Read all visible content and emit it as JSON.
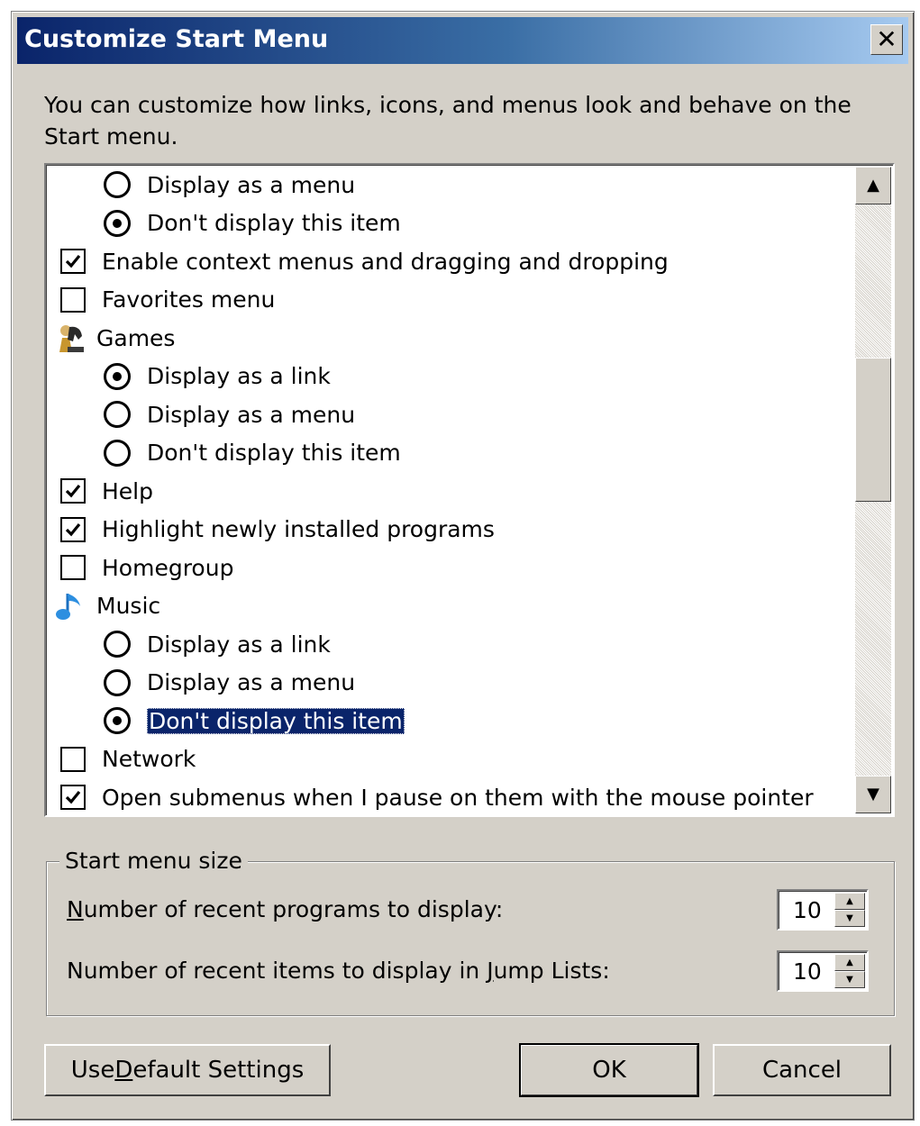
{
  "window": {
    "title": "Customize Start Menu",
    "close_symbol": "✕"
  },
  "intro": "You can customize how links, icons, and menus look and behave on the Start menu.",
  "list": {
    "items": [
      {
        "type": "radio",
        "label": "Display as a menu",
        "checked": false
      },
      {
        "type": "radio",
        "label": "Don't display this item",
        "checked": true
      },
      {
        "type": "checkbox",
        "label": "Enable context menus and dragging and dropping",
        "checked": true
      },
      {
        "type": "checkbox",
        "label": "Favorites menu",
        "checked": false
      },
      {
        "type": "header",
        "label": "Games",
        "icon": "games-chess-icon"
      },
      {
        "type": "radio",
        "label": "Display as a link",
        "checked": true
      },
      {
        "type": "radio",
        "label": "Display as a menu",
        "checked": false
      },
      {
        "type": "radio",
        "label": "Don't display this item",
        "checked": false
      },
      {
        "type": "checkbox",
        "label": "Help",
        "checked": true
      },
      {
        "type": "checkbox",
        "label": "Highlight newly installed programs",
        "checked": true
      },
      {
        "type": "checkbox",
        "label": "Homegroup",
        "checked": false
      },
      {
        "type": "header",
        "label": "Music",
        "icon": "music-note-icon"
      },
      {
        "type": "radio",
        "label": "Display as a link",
        "checked": false
      },
      {
        "type": "radio",
        "label": "Display as a menu",
        "checked": false
      },
      {
        "type": "radio",
        "label": "Don't display this item",
        "checked": true,
        "selected": true
      },
      {
        "type": "checkbox",
        "label": "Network",
        "checked": false
      },
      {
        "type": "checkbox",
        "label": "Open submenus when I pause on them with the mouse pointer",
        "checked": true
      }
    ]
  },
  "start_menu_size": {
    "legend": "Start menu size",
    "recent_programs": {
      "label_accel": "N",
      "label_rest": "umber of recent programs to display:",
      "value": "10"
    },
    "recent_items": {
      "label_pre": "Number of recent items to display in ",
      "label_accel": "J",
      "label_post": "ump Lists:",
      "value": "10"
    }
  },
  "buttons": {
    "defaults": {
      "pre": "Use ",
      "accel": "D",
      "post": "efault Settings"
    },
    "ok": "OK",
    "cancel": "Cancel"
  },
  "colors": {
    "title_start": "#0a246a",
    "title_end": "#a6caf0",
    "selection": "#0a246a",
    "face": "#d4d0c8"
  }
}
